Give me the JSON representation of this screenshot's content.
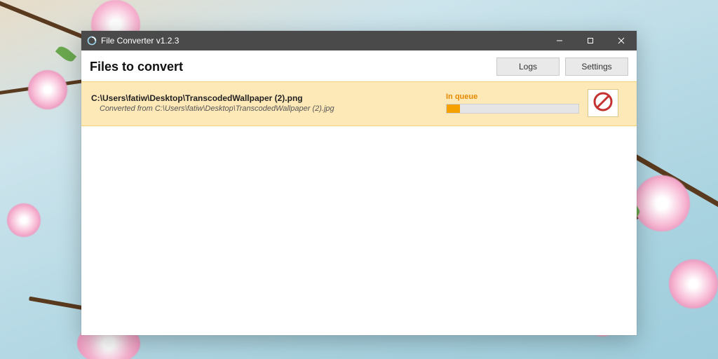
{
  "window": {
    "title": "File Converter v1.2.3"
  },
  "header": {
    "heading": "Files to convert",
    "logs_label": "Logs",
    "settings_label": "Settings"
  },
  "items": [
    {
      "target_path": "C:\\Users\\fatiw\\Desktop\\TranscodedWallpaper (2).png",
      "source_prefix": "Converted from ",
      "source_path": "C:\\Users\\fatiw\\Desktop\\TranscodedWallpaper (2).jpg",
      "status": "In queue",
      "progress_percent": 10
    }
  ],
  "colors": {
    "accent_orange": "#f5a100",
    "item_bg": "#fde8b8",
    "titlebar": "#4a4a4a"
  }
}
